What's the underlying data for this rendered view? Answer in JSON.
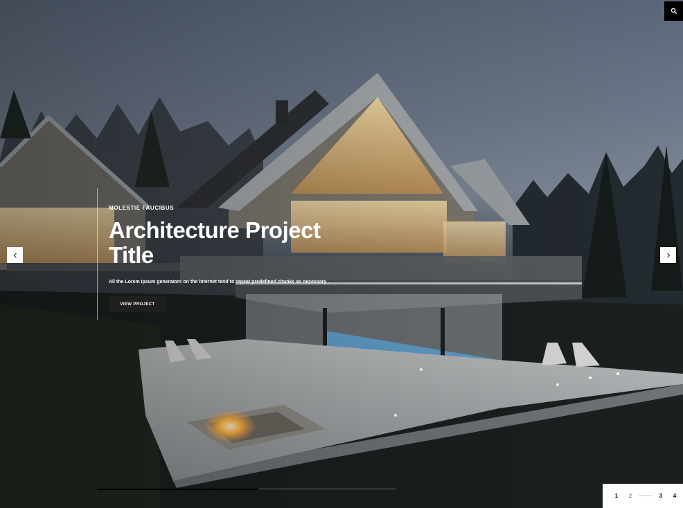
{
  "header": {
    "search_icon": "search-icon"
  },
  "hero": {
    "eyebrow": "MOLESTIE FAUCIBUS",
    "title": "Architecture Project Title",
    "description": "All the Lorem Ipsum generators on the Internet tend to repeat predefined chunks as necessary .",
    "cta_label": "VIEW PROJECT",
    "prev_icon": "chevron-left-icon",
    "next_icon": "chevron-right-icon"
  },
  "slider": {
    "progress": 0.54,
    "pages": [
      "1",
      "2",
      "3",
      "4"
    ],
    "active_page": "2"
  }
}
